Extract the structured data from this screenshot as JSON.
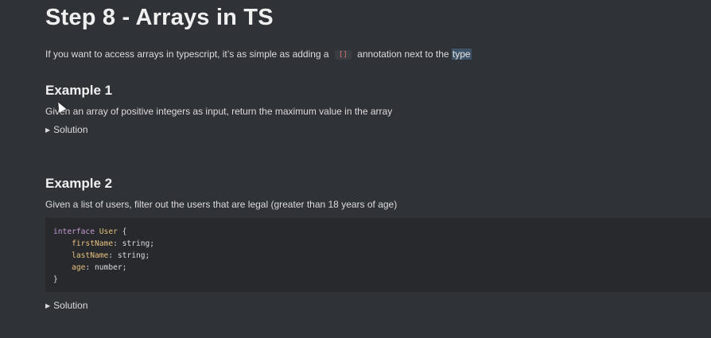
{
  "title": "Step 8 - Arrays in TS",
  "intro": {
    "before": "If you want to access arrays in typescript, it’s as simple as adding a",
    "code": "[]",
    "after": "annotation next to the",
    "highlight": "type"
  },
  "example1": {
    "heading": "Example 1",
    "description": "Given an array of positive integers as input, return the maximum value in the array",
    "toggle_label": "Solution"
  },
  "example2": {
    "heading": "Example 2",
    "description": "Given a list of users, filter out the users that are legal (greater than 18 years of age)",
    "code": {
      "keyword": "interface",
      "type_name": "User",
      "open_brace": "{",
      "fields": [
        {
          "name": "firstName",
          "type": "string;"
        },
        {
          "name": "lastName",
          "type": "string;"
        },
        {
          "name": "age",
          "type": "number;"
        }
      ],
      "close_brace": "}"
    },
    "toggle_label": "Solution"
  },
  "colors": {
    "background": "#2f3237",
    "code_background": "#27292d",
    "keyword": "#c79bd6",
    "type": "#e6c07b",
    "inline_code": "#e0796b",
    "highlight": "#3d5266"
  }
}
